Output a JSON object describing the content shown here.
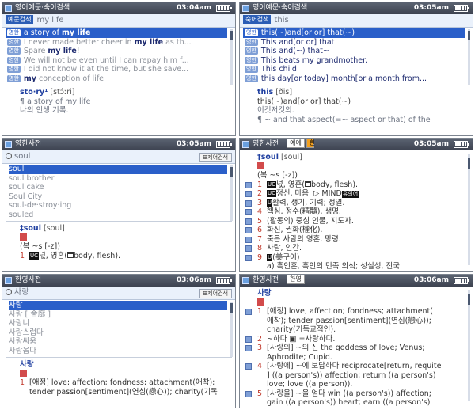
{
  "clock": {
    "p1": "03:04am",
    "p2": "03:05am",
    "p3": "03:05am",
    "p4": "03:05am",
    "p5": "03:06am",
    "p6": "03:06am"
  },
  "p1": {
    "title": "영어예문·숙어검색",
    "mode_chip": "예문검색",
    "query": "my life",
    "rows": [
      {
        "tag": "영한",
        "pre": "a story of ",
        "bold": "my life",
        "post": ""
      },
      {
        "tag": "영한",
        "pre": "I never made better cheer in ",
        "bold": "my life",
        "post": " as th..."
      },
      {
        "tag": "영한",
        "pre": "Spare ",
        "bold": "my life",
        "post": "!"
      },
      {
        "tag": "영한",
        "pre": "We will not be even until I can repay him f...",
        "bold": "",
        "post": ""
      },
      {
        "tag": "영한",
        "pre": "I did not know it at the time, but she save...",
        "bold": "",
        "post": ""
      },
      {
        "tag": "영한",
        "pre": "",
        "bold": "my",
        "post": " conception of life"
      }
    ],
    "detail": {
      "headword": "sto·ry¹",
      "pron": "[stɔ́ːri]",
      "line2": "¶ a story of my life",
      "line3": "나의 인생 기록."
    }
  },
  "p2": {
    "title": "영어예문·숙어검색",
    "mode_chip": "숙어검색",
    "query": "this",
    "rows": [
      {
        "tag": "영한",
        "text": "this(~)and[or or] that(~)"
      },
      {
        "tag": "영한",
        "text": "This and[or or] that"
      },
      {
        "tag": "영한",
        "text": "This and(~) that~"
      },
      {
        "tag": "영한",
        "text": "This beats my grandmother."
      },
      {
        "tag": "영한",
        "text": "This child"
      },
      {
        "tag": "영한",
        "text": "this day[or today] month[or a month from..."
      }
    ],
    "detail": {
      "line1": "this",
      "line1b": "[ðis]",
      "line2": "this(~)and[or or] that(~)",
      "line3": "이것저것의.",
      "line4": "¶ ~ and that aspect(=~ aspect or that) of the"
    }
  },
  "p3": {
    "title": "영한사전",
    "query": "soul",
    "filter": "표제어검색",
    "rows": [
      "soul",
      "soul brother",
      "soul cake",
      "Soul City",
      "soul-de·stroy·ing",
      "souled"
    ],
    "detail": {
      "headword": "‡soul",
      "pron": "[soul]",
      "line3": "(복 ~s [-z])",
      "sense_num": "1",
      "pos": "UC",
      "sense_text": "넋, 영혼(",
      "opp": "body, flesh)."
    }
  },
  "p4": {
    "title": "영한사전",
    "badge1": "예예",
    "badge2": "한",
    "headword": "‡soul",
    "pron": "[soul]",
    "inflection": "(복 ~s [-z])",
    "senses": [
      {
        "num": "1",
        "pos": "UC",
        "text": "넋, 영혼(",
        "extra": "body, flesh)."
      },
      {
        "num": "2",
        "pos": "UC",
        "text": "정신, 마음. ▷ MIND",
        "extra": "유의어"
      },
      {
        "num": "3",
        "pos": "U",
        "text": "활력, 생기, 기력; 정열.",
        "extra": ""
      },
      {
        "num": "4",
        "pos": "",
        "text": "핵심, 정수(精髓), 생명.",
        "extra": ""
      },
      {
        "num": "5",
        "pos": "",
        "text": "(활동의) 중심 인물, 지도자.",
        "extra": ""
      },
      {
        "num": "6",
        "pos": "",
        "text": "화신, 권화(權化).",
        "extra": ""
      },
      {
        "num": "7",
        "pos": "",
        "text": "죽은 사람의 영혼, 망령.",
        "extra": ""
      },
      {
        "num": "8",
        "pos": "",
        "text": "사람, 인간.",
        "extra": ""
      },
      {
        "num": "9",
        "pos": "U",
        "text": "(美구어)",
        "extra": ""
      }
    ],
    "sub": "a) 흑인혼, 흑인의 민족 의식; 성실성, 진국."
  },
  "p5": {
    "title": "한영사전",
    "query": "사랑",
    "filter": "표제어검색",
    "rows": [
      "사랑",
      "사랑 [ 舍廊 ]",
      "사랑니",
      "사랑스럽다",
      "사랑싸움",
      "사랑옵다"
    ],
    "detail": {
      "headword": "사랑",
      "num": "1",
      "text1": "[애정] love; affection; fondness; attachment(애착);",
      "text2": "tender passion[sentiment](연심(戀心)); charity(기독"
    }
  },
  "p6": {
    "title": "한영사전",
    "badge1": "한영",
    "headword": "사랑",
    "lines": [
      {
        "num": "1",
        "text": "[애정] love; affection; fondness; attachment("
      },
      {
        "num": "",
        "text": "애착); tender passion[sentiment](연심(戀心));"
      },
      {
        "num": "",
        "text": "charity(기독교적인)."
      },
      {
        "num": "2",
        "text": "~하다 ▣ =사랑하다."
      },
      {
        "num": "3",
        "text": "[사랑의] ~의 신 the goddess of love; Venus;"
      },
      {
        "num": "",
        "text": "Aphrodite; Cupid."
      },
      {
        "num": "4",
        "text": "[사랑에] ~에 보답하다 reciprocate[return, requite"
      },
      {
        "num": "",
        "text": "] ((a person's)) affection; return ((a person's)"
      },
      {
        "num": "",
        "text": "love; love ((a person))."
      },
      {
        "num": "5",
        "text": "[사랑을] ~을 얻다 win ((a person's)) affection;"
      },
      {
        "num": "",
        "text": "gain ((a person's)) heart; earn ((a person's)"
      }
    ]
  }
}
